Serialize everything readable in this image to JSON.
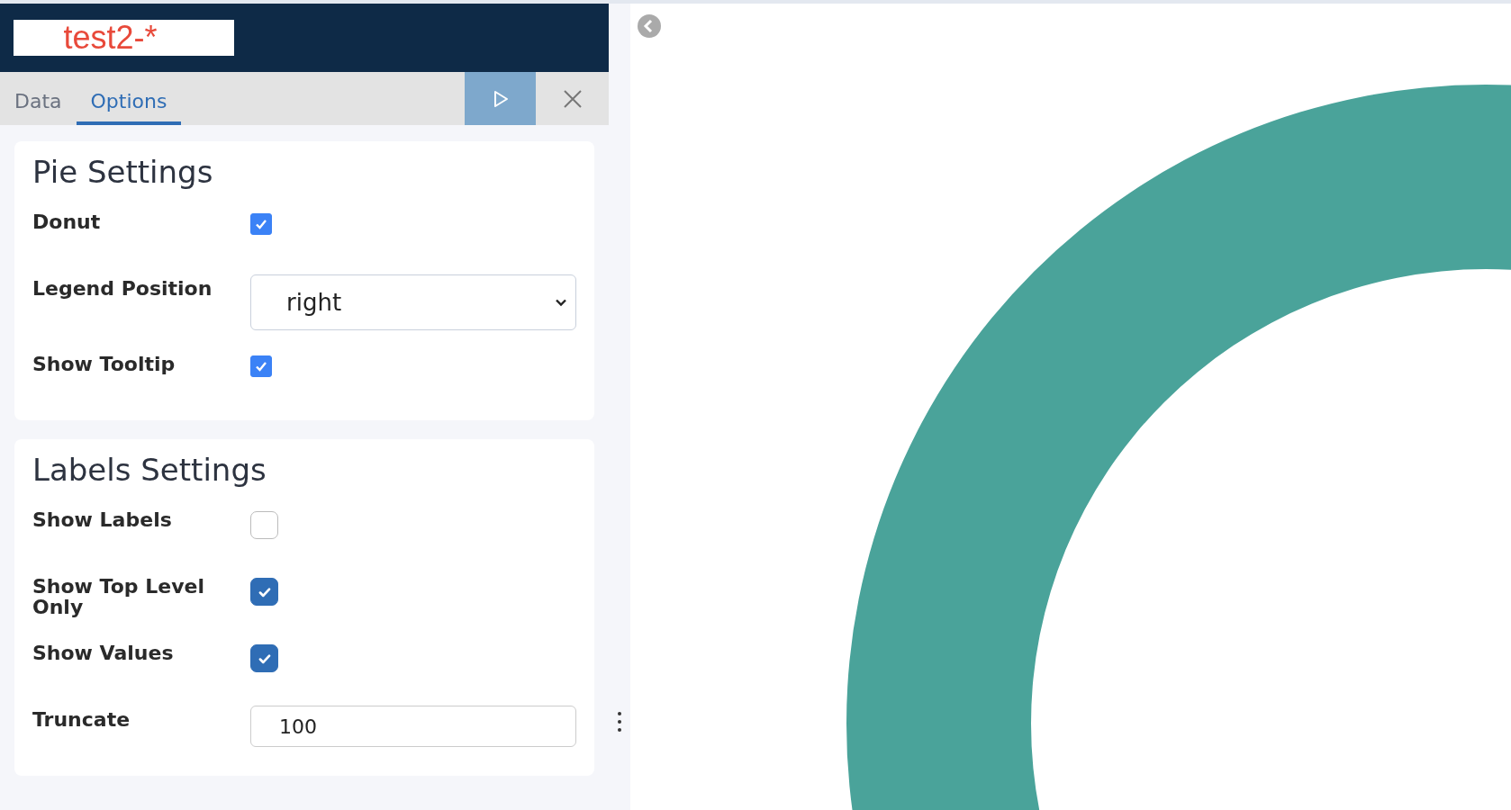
{
  "header": {
    "title": "test2-*"
  },
  "tabs": [
    {
      "label": "Data",
      "selected": false
    },
    {
      "label": "Options",
      "selected": true
    }
  ],
  "sections": [
    {
      "title": "Pie Settings",
      "fields": [
        {
          "kind": "checkbox",
          "label": "Donut",
          "checked": true
        },
        {
          "kind": "select",
          "label": "Legend Position",
          "value": "right"
        },
        {
          "kind": "checkbox",
          "label": "Show Tooltip",
          "checked": true
        }
      ]
    },
    {
      "title": "Labels Settings",
      "fields": [
        {
          "kind": "custom-checkbox",
          "label": "Show Labels",
          "checked": false
        },
        {
          "kind": "custom-checkbox",
          "label": "Show Top Level Only",
          "checked": true
        },
        {
          "kind": "custom-checkbox",
          "label": "Show Values",
          "checked": true
        },
        {
          "kind": "input",
          "label": "Truncate",
          "value": "100"
        }
      ]
    }
  ]
}
